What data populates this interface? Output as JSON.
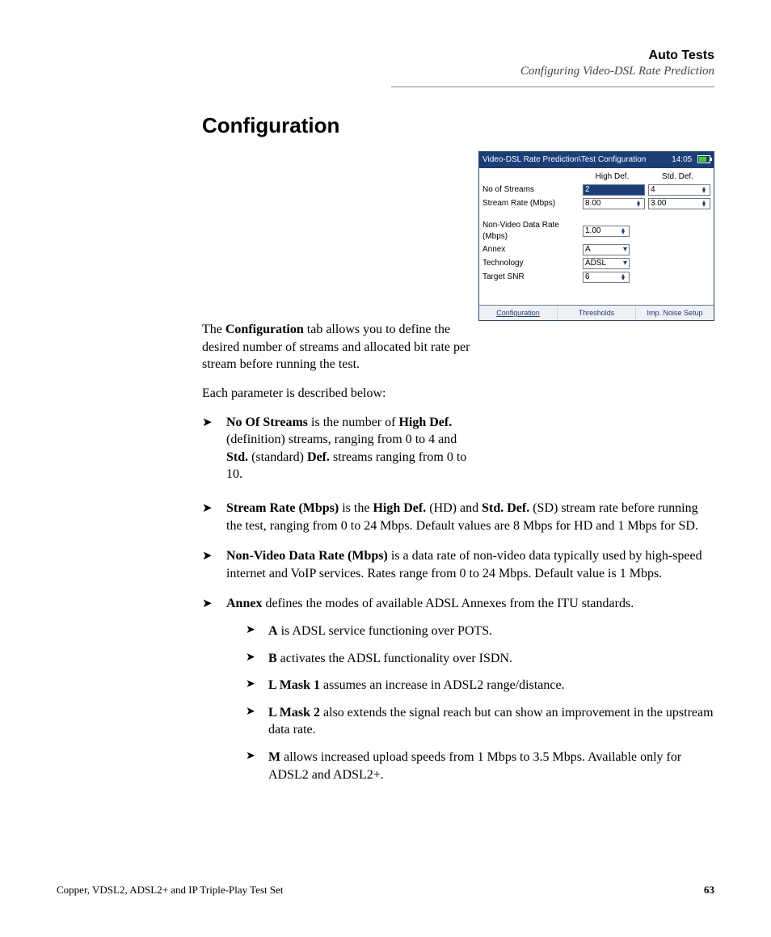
{
  "header": {
    "chapter": "Auto Tests",
    "subtitle": "Configuring Video-DSL Rate Prediction"
  },
  "section_title": "Configuration",
  "intro": {
    "p1_a": "The ",
    "p1_b": "Configuration",
    "p1_c": " tab allows you to define the desired number of streams and allocated bit rate per stream before running the test.",
    "p2": "Each parameter is described below:"
  },
  "screenshot": {
    "title": "Video-DSL Rate Prediction\\Test Configuration",
    "time": "14:05",
    "col_hd": "High Def.",
    "col_sd": "Std. Def.",
    "rows": {
      "no_streams_label": "No of Streams",
      "no_streams_hd": "2",
      "no_streams_sd": "4",
      "stream_rate_label": "Stream Rate (Mbps)",
      "stream_rate_hd": "8.00",
      "stream_rate_sd": "3.00",
      "nonvideo_label": "Non-Video Data Rate (Mbps)",
      "nonvideo_val": "1.00",
      "annex_label": "Annex",
      "annex_val": "A",
      "tech_label": "Technology",
      "tech_val": "ADSL",
      "snr_label": "Target SNR",
      "snr_val": "6"
    },
    "tabs": [
      "Configuration",
      "Thresholds",
      "Imp. Noise Setup"
    ]
  },
  "bullets": {
    "b1_a": "No Of Streams",
    "b1_b": " is the number of ",
    "b1_c": "High Def.",
    "b1_d": " (definition) streams, ranging from 0 to 4 and ",
    "b1_e": "Std.",
    "b1_f": " (standard) ",
    "b1_g": "Def.",
    "b1_h": " streams ranging from 0 to 10.",
    "b2_a": "Stream Rate (Mbps)",
    "b2_b": " is the ",
    "b2_c": "High Def.",
    "b2_d": " (HD) and ",
    "b2_e": "Std. Def.",
    "b2_f": " (SD) stream rate before running the test, ranging from 0 to 24 Mbps. Default values are 8 Mbps for HD and 1 Mbps for SD.",
    "b3_a": "Non-Video Data Rate (Mbps)",
    "b3_b": " is a data rate of non-video data typically used by high-speed internet and VoIP services. Rates range from 0 to 24 Mbps. Default value is 1 Mbps.",
    "b4_a": "Annex",
    "b4_b": " defines the modes of available ADSL Annexes from the ITU standards.",
    "b4s1_a": "A",
    "b4s1_b": " is ADSL service functioning over POTS.",
    "b4s2_a": "B",
    "b4s2_b": " activates the ADSL functionality over ISDN.",
    "b4s3_a": "L Mask 1",
    "b4s3_b": " assumes an increase in ADSL2 range/distance.",
    "b4s4_a": "L Mask 2",
    "b4s4_b": " also extends the signal reach but can show an improvement in the upstream data rate.",
    "b4s5_a": "M",
    "b4s5_b": " allows increased upload speeds from 1 Mbps to 3.5 Mbps. Available only for ADSL2 and ADSL2+."
  },
  "footer": {
    "left": "Copper, VDSL2, ADSL2+ and IP Triple-Play Test Set",
    "page": "63"
  }
}
